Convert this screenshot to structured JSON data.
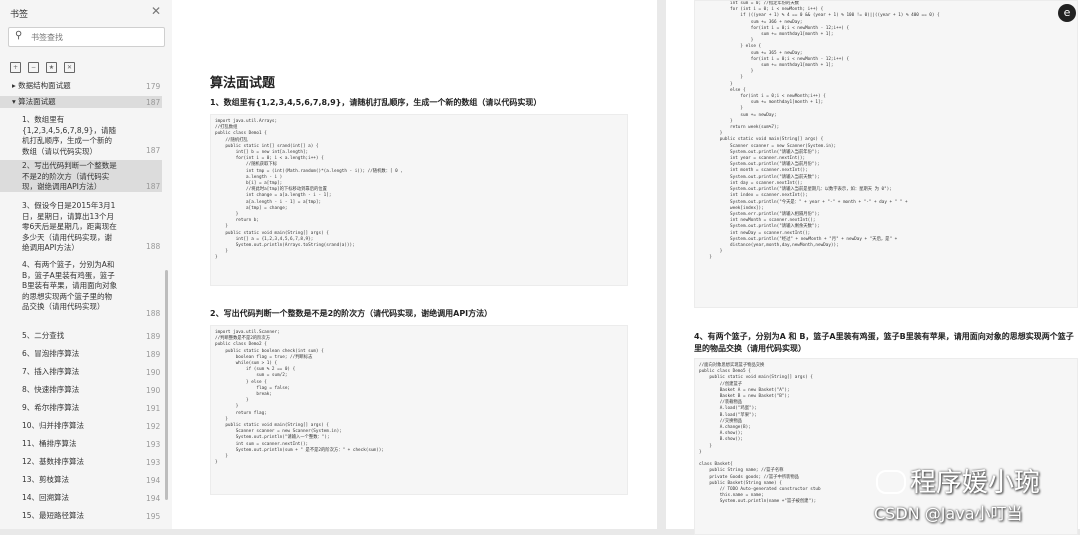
{
  "sidebar": {
    "title": "书签",
    "search_placeholder": "书签查找",
    "items": [
      {
        "label": "▸ 数据结构面试题",
        "page": "179"
      },
      {
        "label": "▾ 算法面试题",
        "page": "187"
      },
      {
        "label": "1、数组里有{1,2,3,4,5,6,7,8,9}，请随机打乱顺序，生成一个新的数组（请以代码实现）",
        "page": "187"
      },
      {
        "label": "2、写出代码判断一个整数是不是2的阶次方（请代码实现，谢绝调用API方法）",
        "page": "187"
      },
      {
        "label": "3、假设今日是2015年3月1日，星期日，请算出13个月零6天后是星期几，距离现在多少天（请用代码实现，谢绝调用API方法）",
        "page": "188"
      },
      {
        "label": "4、有两个篮子，分别为A和B，篮子A里装有鸡蛋，篮子B里装有苹果，请用面向对象的思想实现两个篮子里的物品交换（请用代码实现）",
        "page": "188"
      },
      {
        "label": "5、二分查找",
        "page": "189"
      },
      {
        "label": "6、冒泡排序算法",
        "page": "189"
      },
      {
        "label": "7、插入排序算法",
        "page": "190"
      },
      {
        "label": "8、快速排序算法",
        "page": "190"
      },
      {
        "label": "9、希尔排序算法",
        "page": "191"
      },
      {
        "label": "10、归并排序算法",
        "page": "192"
      },
      {
        "label": "11、桶排序算法",
        "page": "193"
      },
      {
        "label": "12、基数排序算法",
        "page": "193"
      },
      {
        "label": "13、剪枝算法",
        "page": "194"
      },
      {
        "label": "14、回溯算法",
        "page": "194"
      },
      {
        "label": "15、最短路径算法",
        "page": "195"
      }
    ]
  },
  "doc": {
    "heading": "算法面试题",
    "q1": "1、数组里有{1,2,3,4,5,6,7,8,9}，请随机打乱顺序，生成一个新的数组（请以代码实现）",
    "q2": "2、写出代码判断一个整数是不是2的阶次方（请代码实现，谢绝调用API方法）",
    "q4": "4、有两个篮子，分别为A 和 B，篮子A里装有鸡蛋，篮子B里装有苹果，请用面向对象的思想实现两个篮子里的物品交换（请用代码实现）",
    "code1": "import java.util.Arrays;\n//打乱数组\npublic class Demo1 {\n    //随机打乱\n    public static int[] srand(int[] a) {\n        int[] b = new int[a.length];\n        for(int i = 0; i < a.length;i++) {\n            //随机获取下标\n            int tmp = (int)(Math.random()*(a.length - i)); //随机数：[ 0 ,\n            a.length - i )\n            b[i] = a[tmp];\n            //将此时a[tmp]的下标移动到靠后的位置\n            int change = a[a.length - i - 1];\n            a[a.length - i - 1] = a[tmp];\n            a[tmp] = change;\n        }\n        return b;\n    }\n    public static void main(String[] args) {\n        int[] a = {1,2,3,4,5,6,7,8,9};\n        System.out.println(Arrays.toString(srand(a)));\n    }\n}",
    "code2": "import java.util.Scanner;\n//判断整数是不是2的阶次方\npublic class Demo2 {\n    public static boolean check(int sum) {\n        boolean flag = true; //判断标志\n        while(sum > 1) {\n            if (sum % 2 == 0) {\n                sum = sum/2;\n            } else {\n                flag = false;\n                break;\n            }\n        }\n        return flag;\n    }\n    public static void main(String[] args) {\n        Scanner scanner = new Scanner(System.in);\n        System.out.println(\"请输入一个整数：\");\n        int sum = scanner.nextInt();\n        System.out.println(sum + \" 是不是2的阶次方：\" + check(sum));\n    }\n}",
    "code3": "            int sum = 0; //指定年份的天数\n            for (int i = 0; i < newMonth; i++) {\n                if (((year + 1) % 4 == 0 && (year + 1) % 100 != 0)||((year + 1) % 400 == 0) {\n                    sum += 366 + newDay;\n                    for(int i = 0;i < newMonth - 12;i++) {\n                        sum += monthday1[month + 1];\n                    }\n                } else {\n                    sum += 365 + newDay;\n                    for(int i = 0;i < newMonth - 12;i++) {\n                        sum += monthday1[month + 1];\n                    }\n                }\n            }\n            else {\n                for(int i = 0;i < newMonth;i++) {\n                    sum += monthday1[month + 1];\n                }\n                sum += newDay;\n            }\n            return week(sum%7);\n        }\n        public static void main(String[] args) {\n            Scanner scanner = new Scanner(System.in);\n            System.out.println(\"请输入当前年份\");\n            int year = scanner.nextInt();\n            System.out.println(\"请输入当前月份\");\n            int month = scanner.nextInt();\n            System.out.println(\"请输入当前天数\");\n            int day = scanner.nextInt();\n            System.out.println(\"请输入当前是星期几：以数字表示，如：星期天 为 0\");\n            int index = scanner.nextInt();\n            System.out.println(\"今天是：\" + year + \"-\" + month + \"-\" + day + \" \" +\n            week[index]);\n            System.err.println(\"请输入相隔月份\");\n            int newMonth = scanner.nextInt();\n            System.out.println(\"请输入剩余天数\");\n            int newDay = scanner.nextInt();\n            System.out.println(\"经过\" + newMonth + \"月\" + newDay + \"天后，是\" +\n            distance(year,month,day,newMonth,newDay));\n        }\n    }",
    "code4": "//面向对象思想实现篮子物品交换\npublic class Demo5 {\n    public static void main(String[] args) {\n        //创建篮子\n        Basket A = new Basket(\"A\");\n        Basket B = new Basket(\"B\");\n        //装载物品\n        A.load(\"鸡蛋\");\n        B.load(\"苹果\");\n        //交换物品\n        A.change(B);\n        A.show();\n        B.show();\n    }\n}\n\nclass Basket{\n    public String name; //篮子名称\n    private Goods goods; //篮子中所装物品\n    public Basket(String name) {\n        // TODO Auto-generated constructor stub\n        this.name = name;\n        System.out.println(name +\"篮子被创建\");"
  },
  "watermark": {
    "line1": "程序媛小琬",
    "line2": "CSDN @Java小叮当"
  },
  "avatar_letter": "e"
}
